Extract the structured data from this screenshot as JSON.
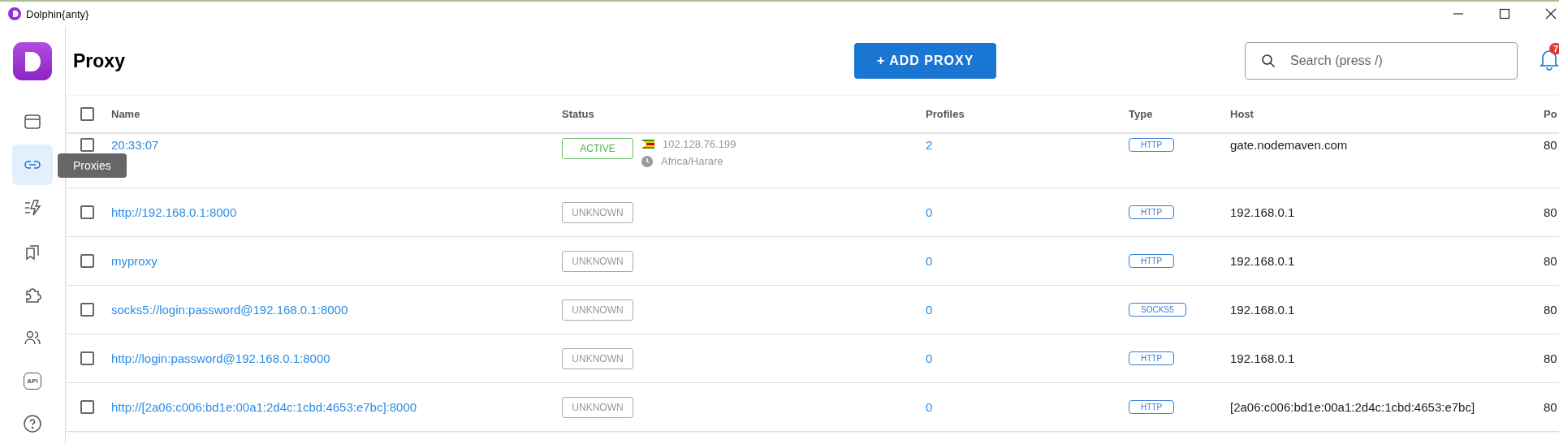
{
  "window": {
    "title": "Dolphin{anty}"
  },
  "sidebar": {
    "items": [
      {
        "kind": "browser",
        "selected": false
      },
      {
        "kind": "link",
        "selected": true
      },
      {
        "kind": "automation",
        "selected": false
      },
      {
        "kind": "bookmarks",
        "selected": false
      },
      {
        "kind": "extensions",
        "selected": false
      },
      {
        "kind": "users",
        "selected": false
      },
      {
        "kind": "api",
        "selected": false,
        "text": "API"
      },
      {
        "kind": "help",
        "selected": false
      }
    ],
    "tooltip": "Proxies"
  },
  "header": {
    "title": "Proxy",
    "add_button": "+ ADD PROXY",
    "search": {
      "placeholder": "Search (press /)"
    },
    "notifications": "7"
  },
  "table": {
    "select_all_checked": false,
    "columns": [
      "Name",
      "Status",
      "Profiles",
      "Type",
      "Host",
      "Po"
    ],
    "rows": [
      {
        "name": "20:33:07",
        "status": "ACTIVE",
        "ip": "102.128.76.199",
        "timezone": "Africa/Harare",
        "profiles": "2",
        "type": "HTTP",
        "host": "gate.nodemaven.com",
        "port": "80",
        "checked": false
      },
      {
        "name": "http://192.168.0.1:8000",
        "status": "UNKNOWN",
        "profiles": "0",
        "type": "HTTP",
        "host": "192.168.0.1",
        "port": "80",
        "checked": false
      },
      {
        "name": "myproxy",
        "status": "UNKNOWN",
        "profiles": "0",
        "type": "HTTP",
        "host": "192.168.0.1",
        "port": "80",
        "checked": false
      },
      {
        "name": "socks5://login:password@192.168.0.1:8000",
        "status": "UNKNOWN",
        "profiles": "0",
        "type": "SOCKS5",
        "host": "192.168.0.1",
        "port": "80",
        "checked": false
      },
      {
        "name": "http://login:password@192.168.0.1:8000",
        "status": "UNKNOWN",
        "profiles": "0",
        "type": "HTTP",
        "host": "192.168.0.1",
        "port": "80",
        "checked": false
      },
      {
        "name": "http://[2a06:c006:bd1e:00a1:2d4c:1cbd:4653:e7bc]:8000",
        "status": "UNKNOWN",
        "profiles": "0",
        "type": "HTTP",
        "host": "[2a06:c006:bd1e:00a1:2d4c:1cbd:4653:e7bc]",
        "port": "80",
        "checked": false
      }
    ]
  }
}
